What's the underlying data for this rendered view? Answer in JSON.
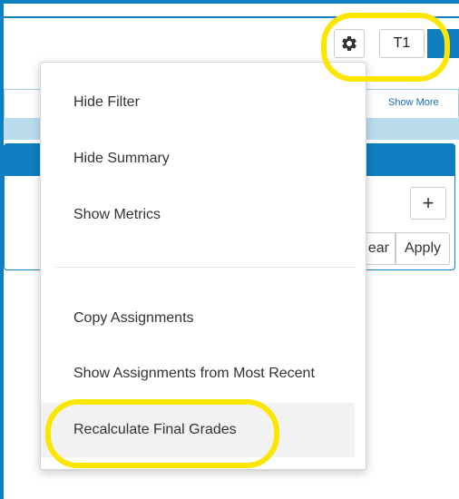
{
  "header": {
    "settings_icon": "gear-icon",
    "term_label": "T1"
  },
  "filter": {
    "show_more_label": "Show More"
  },
  "controls": {
    "plus_label": "+",
    "clear_label_visible": "ear",
    "apply_label": "Apply"
  },
  "menu": {
    "items": [
      {
        "label": "Hide Filter"
      },
      {
        "label": "Hide Summary"
      },
      {
        "label": "Show Metrics"
      },
      {
        "label": "Copy Assignments"
      },
      {
        "label": "Show Assignments from Most Recent"
      },
      {
        "label": "Recalculate Final Grades"
      }
    ]
  },
  "colors": {
    "accent": "#0f7ec0",
    "light_accent": "#b9dcec",
    "highlight": "#fbe600",
    "menu_text": "#333333",
    "hover_bg": "#f2f2f2"
  }
}
